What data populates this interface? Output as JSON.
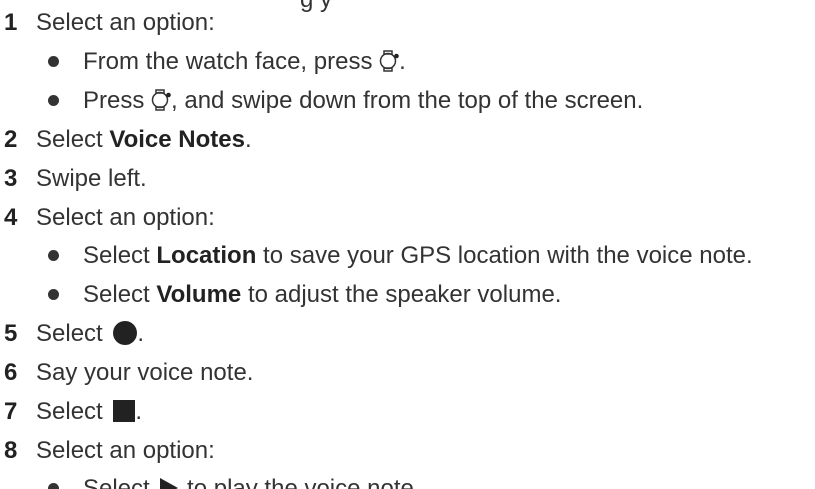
{
  "cut_off_heading": "g y",
  "steps": [
    {
      "num": "1",
      "text": "Select an option:",
      "bullets": [
        {
          "before": "From the watch face, press ",
          "after": "."
        },
        {
          "before": "Press ",
          "after": ", and swipe down from the top of the screen."
        }
      ]
    },
    {
      "num": "2",
      "before": "Select ",
      "bold": "Voice Notes",
      "after": "."
    },
    {
      "num": "3",
      "text": "Swipe left."
    },
    {
      "num": "4",
      "text": "Select an option:",
      "bullets": [
        {
          "before": "Select ",
          "bold": "Location",
          "after": " to save your GPS location with the voice note."
        },
        {
          "before": "Select ",
          "bold": "Volume",
          "after": " to adjust the speaker volume."
        }
      ]
    },
    {
      "num": "5",
      "before": "Select ",
      "after": "."
    },
    {
      "num": "6",
      "text": "Say your voice note."
    },
    {
      "num": "7",
      "before": "Select ",
      "after": "."
    },
    {
      "num": "8",
      "text": "Select an option:",
      "bullets": [
        {
          "before": "Select ",
          "after": " to play the voice note."
        }
      ]
    }
  ],
  "icons": {
    "watch": "watch-button-icon",
    "record": "record-icon",
    "stop": "stop-icon",
    "play": "play-icon"
  }
}
